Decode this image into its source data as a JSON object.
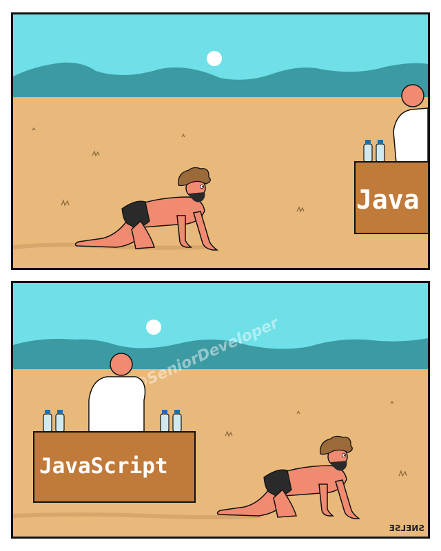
{
  "panel_top": {
    "sign_label": "Java"
  },
  "panel_bottom": {
    "sign_label": "JavaScript"
  },
  "watermark": "@SeniorDeveloper",
  "signature": "SNELSE",
  "colors": {
    "sky": "#6fe0e8",
    "mountains": "#3c9aa3",
    "sand": "#e8b97a",
    "table": "#c07a3a",
    "skin": "#f08a70",
    "hair": "#9a6a3a"
  }
}
